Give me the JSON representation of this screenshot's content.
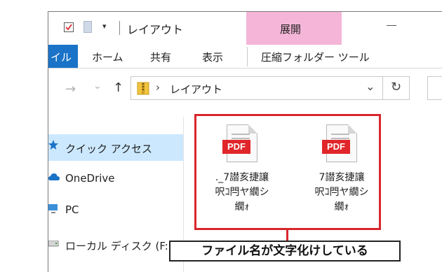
{
  "window": {
    "title": "レイアウト",
    "qat_dropdown": "▾",
    "context_tab": "展開"
  },
  "ribbon": {
    "file_tab": "イル",
    "tabs": [
      "ホーム",
      "共有",
      "表示",
      "圧縮フォルダー ツール"
    ]
  },
  "nav": {
    "back": "→",
    "recent": "⌄",
    "up": "↑",
    "path_separator": "›",
    "path": "レイアウト",
    "path_dropdown": "⌄",
    "refresh": "↻"
  },
  "sidebar": {
    "items": [
      {
        "label": "クイック アクセス",
        "icon": "star-icon",
        "selected": true
      },
      {
        "label": "OneDrive",
        "icon": "cloud-icon"
      },
      {
        "label": "PC",
        "icon": "pc-icon"
      },
      {
        "label": "ローカル ディスク (F:)",
        "icon": "drive-icon"
      }
    ]
  },
  "files": [
    {
      "badge": "PDF",
      "name": "._7譛亥捷讓\n呎ｺ閂ヤ繝シ\n繝ｫ",
      "icon": "pdf-file-icon"
    },
    {
      "badge": "PDF",
      "name": "7譛亥捷讓\n呎ｺ閂ヤ繝シ\n繝ｫ",
      "icon": "pdf-file-icon"
    }
  ],
  "annotation": {
    "label": "ファイル名が文字化けしている",
    "color": "#d8262c"
  },
  "colors": {
    "context_tab": "#f5b5d8",
    "file_tab": "#1a73c7",
    "selection": "#cce8ff",
    "pdf_red": "#e0262a"
  }
}
